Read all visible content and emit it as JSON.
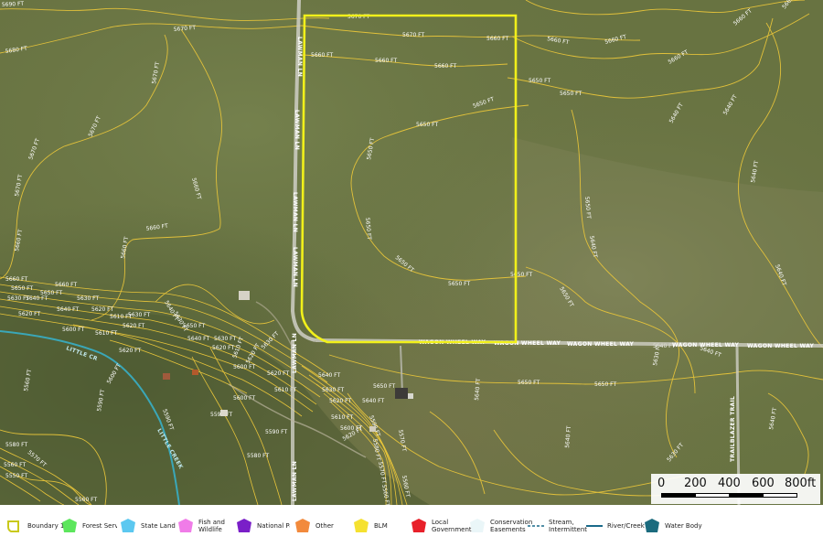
{
  "contours": {
    "c5690": "5690 FT",
    "c5680": "5680 FT",
    "c5670": "5670 FT",
    "c5660": "5660 FT",
    "c5650": "5650 FT",
    "c5640": "5640 FT",
    "c5630": "5630 FT",
    "c5620": "5620 FT",
    "c5610": "5610 FT",
    "c5600": "5600 FT",
    "c5590": "5590 FT",
    "c5580": "5580 FT",
    "c5570": "5570 FT",
    "c5560": "5560 FT",
    "c5550": "5550 FT"
  },
  "roads": {
    "lawman_a": "LAWMAN LN",
    "lawman_b": "LAWMAN LN",
    "lawman_c": "LAWMAN LN",
    "lawman_d": "LAWMAN LN",
    "wagon_1": "WAGON WHEEL WAY",
    "wagon_2": "WAGON WHEEL WAY",
    "wagon_3": "WAGON WHEEL WAY",
    "wagon_4": "WAGON WHEEL WAY",
    "wagon_5": "WAGON WHEEL WAY",
    "trailblazer": "TRAILBLAZER TRAIL",
    "creek_a": "LITTLE CR",
    "creek_b": "LITTLE CREEK"
  },
  "scale": {
    "labels": [
      "0",
      "200",
      "400",
      "600",
      "800ft"
    ]
  },
  "legend": [
    {
      "label": "Boundary 1",
      "color": "#e6e600",
      "icon": "boundary-outline-icon"
    },
    {
      "label": "Forest Service",
      "color": "#5ce65c",
      "icon": "forest-service-swatch-icon"
    },
    {
      "label": "State Land",
      "color": "#5cc8f0",
      "icon": "state-land-swatch-icon"
    },
    {
      "label": "Fish and Wildlife",
      "color": "#f07ce8",
      "icon": "fish-wildlife-swatch-icon"
    },
    {
      "label": "National Park",
      "color": "#7a1fc8",
      "icon": "national-park-swatch-icon"
    },
    {
      "label": "Other",
      "color": "#f28a3c",
      "icon": "other-swatch-icon"
    },
    {
      "label": "BLM",
      "color": "#f5e130",
      "icon": "blm-swatch-icon"
    },
    {
      "label": "Local Government",
      "color": "#e8202a",
      "icon": "local-government-swatch-icon"
    },
    {
      "label": "Conservation Easements",
      "color": "#eaf6f8",
      "icon": "conservation-swatch-icon"
    },
    {
      "label": "Stream, Intermittent",
      "color": "#1a6a8a",
      "icon": "stream-intermittent-line-icon"
    },
    {
      "label": "River/Creek",
      "color": "#1a6a8a",
      "icon": "river-creek-line-icon"
    },
    {
      "label": "Water Body",
      "color": "#1b6b7e",
      "icon": "water-body-swatch-icon"
    }
  ]
}
